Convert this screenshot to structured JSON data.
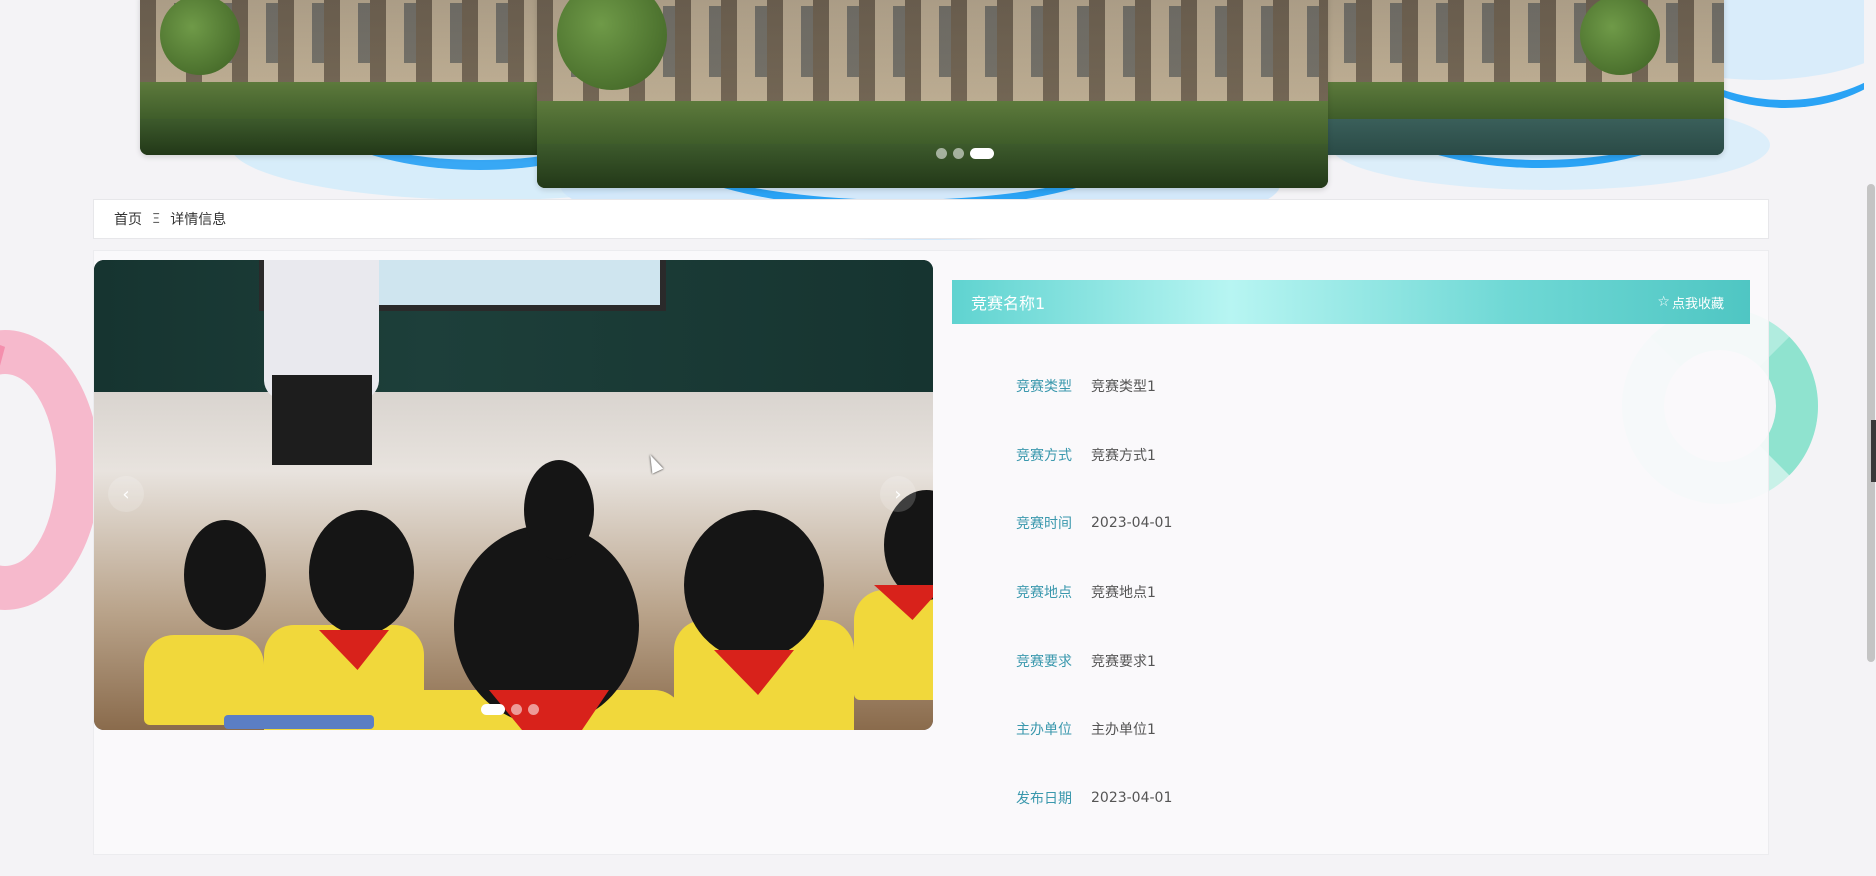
{
  "breadcrumb": {
    "home": "首页",
    "separator": "Ξ",
    "current": "详情信息"
  },
  "top_carousel": {
    "slides": 3,
    "active_index": 2
  },
  "photo_carousel": {
    "prev_symbol": "‹",
    "next_symbol": "›",
    "slides": 3,
    "active_index": 0
  },
  "detail": {
    "title": "竞赛名称1",
    "favorite_label": "点我收藏",
    "favorite_icon": "☆",
    "fields": [
      {
        "label": "竞赛类型",
        "value": "竞赛类型1"
      },
      {
        "label": "竞赛方式",
        "value": "竞赛方式1"
      },
      {
        "label": "竞赛时间",
        "value": "2023-04-01"
      },
      {
        "label": "竞赛地点",
        "value": "竞赛地点1"
      },
      {
        "label": "竞赛要求",
        "value": "竞赛要求1"
      },
      {
        "label": "主办单位",
        "value": "主办单位1"
      },
      {
        "label": "发布日期",
        "value": "2023-04-01"
      }
    ]
  },
  "colors": {
    "label": "#3a98ad",
    "title_bar_start": "#5fd3d0",
    "title_bar_light": "#b7f5f2",
    "background": "#f4f3f6"
  }
}
